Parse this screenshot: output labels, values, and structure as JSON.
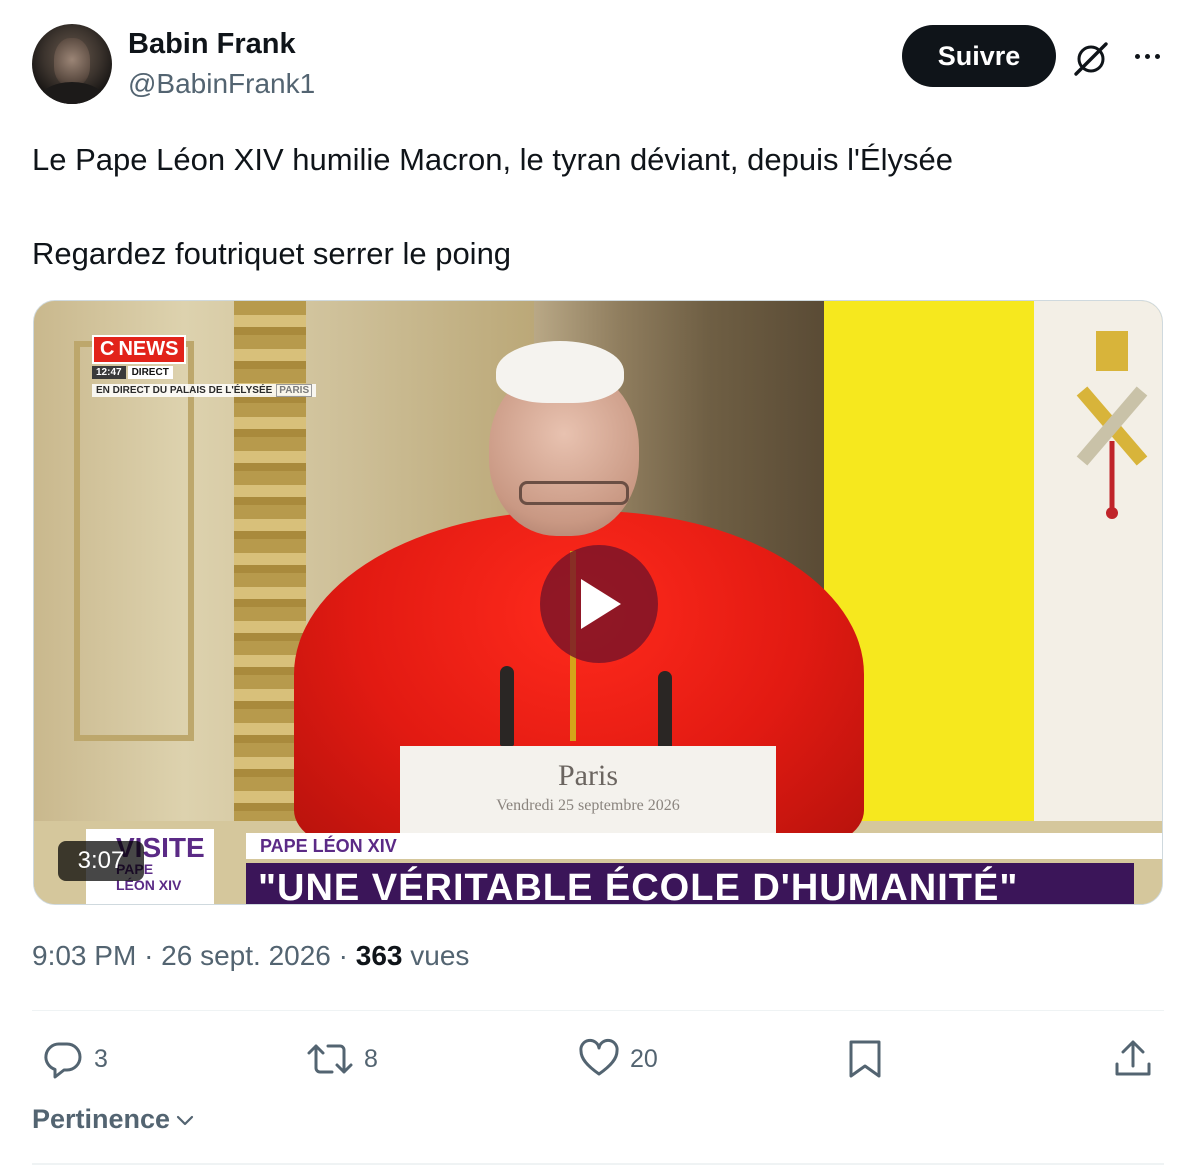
{
  "author": {
    "name": "Babin Frank",
    "handle": "@BabinFrank1",
    "avatar_icon": "avatar"
  },
  "header_actions": {
    "follow_label": "Suivre",
    "grok_icon": "grok-icon",
    "more_icon": "more-options-icon"
  },
  "tweet": {
    "paragraphs": [
      "Le Pape Léon XIV humilie Macron, le tyran déviant, depuis l'Élysée",
      "Regardez foutriquet serrer le poing"
    ]
  },
  "video": {
    "duration": "3:07",
    "channel_logo": "NEWS",
    "channel_letter": "C",
    "time": "12:47",
    "live_label": "DIRECT",
    "subtitle": "EN DIRECT DU PALAIS DE L'ÉLYSÉE",
    "location_tag": "PARIS",
    "lectern_city": "Paris",
    "lectern_date": "Vendredi 25 septembre 2026",
    "corner_title": "VISITE",
    "corner_sub1": "PAPE",
    "corner_sub2": "LÉON XIV",
    "banner_top": "PAPE LÉON XIV",
    "banner_main": "\"UNE VÉRITABLE ÉCOLE D'HUMANITÉ\""
  },
  "meta": {
    "time": "9:03 PM",
    "sep1": "·",
    "date": "26 sept. 2026",
    "sep2": "·",
    "views_count": "363",
    "views_label": "vues"
  },
  "actions": {
    "replies": "3",
    "reposts": "8",
    "likes": "20"
  },
  "sort": {
    "label": "Pertinence"
  }
}
